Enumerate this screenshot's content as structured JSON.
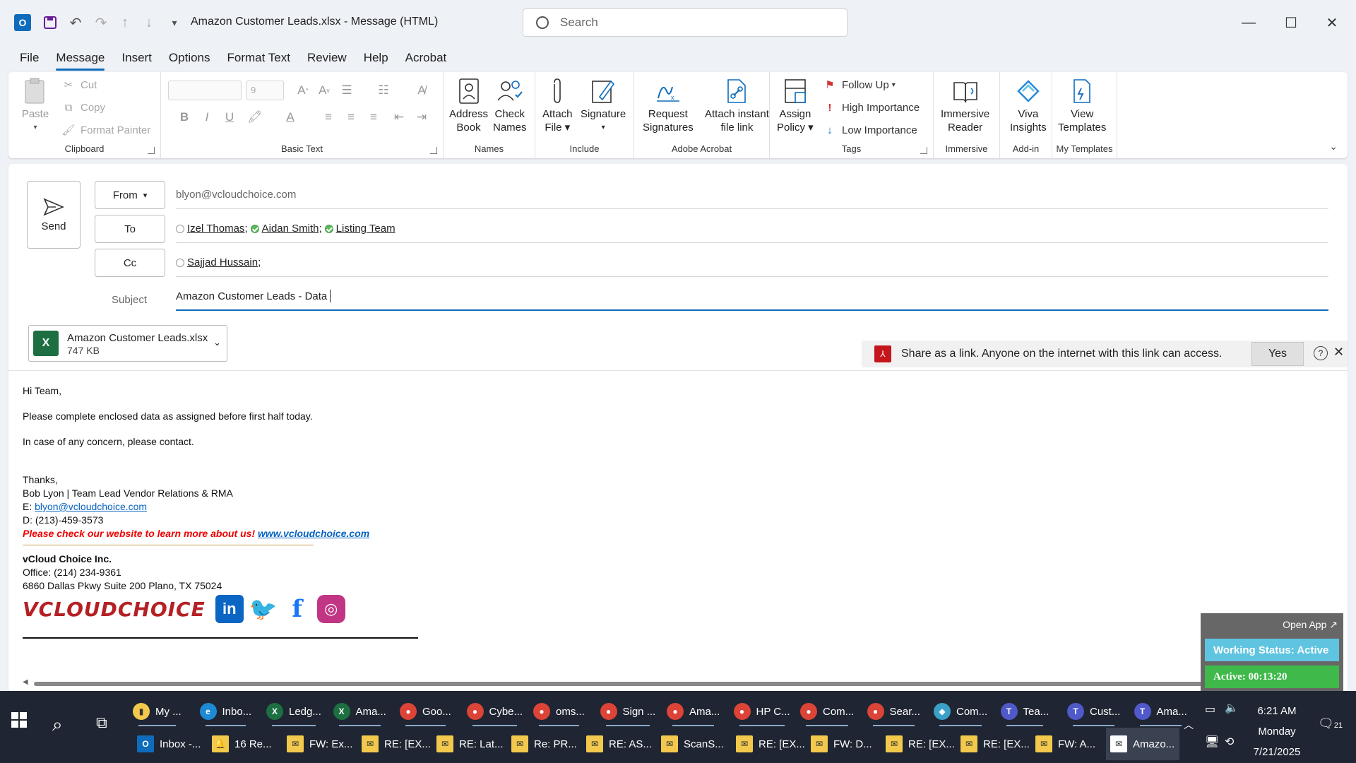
{
  "window": {
    "title": "Amazon Customer Leads.xlsx  -  Message (HTML)",
    "search_placeholder": "Search"
  },
  "menu": [
    "File",
    "Message",
    "Insert",
    "Options",
    "Format Text",
    "Review",
    "Help",
    "Acrobat"
  ],
  "ribbon": {
    "clipboard": {
      "paste": "Paste",
      "cut": "Cut",
      "copy": "Copy",
      "format_painter": "Format Painter",
      "label": "Clipboard"
    },
    "basic_text": {
      "font_size": "9",
      "label": "Basic Text"
    },
    "names": {
      "address_book_1": "Address",
      "address_book_2": "Book",
      "check_names_1": "Check",
      "check_names_2": "Names",
      "label": "Names"
    },
    "include": {
      "attach_1": "Attach",
      "attach_2": "File",
      "signature": "Signature",
      "label": "Include"
    },
    "acrobat": {
      "request_1": "Request",
      "request_2": "Signatures",
      "instant_1": "Attach instant",
      "instant_2": "file link",
      "label": "Adobe Acrobat"
    },
    "tags": {
      "assign_1": "Assign",
      "assign_2": "Policy",
      "follow_up": "Follow Up",
      "high": "High Importance",
      "low": "Low Importance",
      "label": "Tags"
    },
    "immersive": {
      "btn_1": "Immersive",
      "btn_2": "Reader",
      "label": "Immersive"
    },
    "addin": {
      "btn_1": "Viva",
      "btn_2": "Insights",
      "label": "Add-in"
    },
    "templates": {
      "btn_1": "View",
      "btn_2": "Templates",
      "label": "My Templates"
    }
  },
  "compose": {
    "send": "Send",
    "from_label": "From",
    "from_value": "blyon@vcloudchoice.com",
    "to_label": "To",
    "to": [
      {
        "name": "Izel Thomas",
        "status": "empty"
      },
      {
        "name": "Aidan Smith",
        "status": "green"
      },
      {
        "name": "Listing Team",
        "status": "green"
      }
    ],
    "cc_label": "Cc",
    "cc": [
      {
        "name": "Sajjad Hussain",
        "status": "empty"
      }
    ],
    "subject_label": "Subject",
    "subject_value": "Amazon Customer Leads -  Data",
    "attachment": {
      "name": "Amazon Customer Leads.xlsx",
      "size": "747 KB"
    },
    "share_text": "Share as a link. Anyone on the internet with this link can access.",
    "share_yes": "Yes"
  },
  "body": {
    "greeting": "Hi Team,",
    "line1": "Please complete enclosed data as assigned before first half today.",
    "line2": "In case of any concern, please contact.",
    "thanks": "Thanks,",
    "sig_name": "Bob Lyon | Team Lead Vendor Relations & RMA",
    "email_prefix": "E: ",
    "email": "blyon@vcloudchoice.com",
    "phone": "D: (213)-459-3573",
    "promo": "Please check our website to learn more about us! ",
    "website": "www.vcloudchoice.com",
    "company": "vCloud Choice Inc.",
    "office": "Office: (214) 234-9361",
    "address": "6860 Dallas Pkwy Suite 200 Plano, TX 75024",
    "logo_text": "VCLOUDCHOICE"
  },
  "widget": {
    "open_app": "Open App ↗",
    "status": "Working Status: Active",
    "active": "Active: 00:13:20"
  },
  "taskbar": {
    "row1": [
      {
        "label": "My ...",
        "icon": "folder-icon",
        "color": "#f2c94c"
      },
      {
        "label": "Inbo...",
        "icon": "edge-icon",
        "color": "#1e8ad6"
      },
      {
        "label": "Ledg...",
        "icon": "excel-icon",
        "color": "#1d6f42"
      },
      {
        "label": "Ama...",
        "icon": "excel-icon",
        "color": "#1d6f42"
      },
      {
        "label": "Goo...",
        "icon": "chrome-icon",
        "color": "#db4437"
      },
      {
        "label": "Cybe...",
        "icon": "chrome-icon",
        "color": "#db4437"
      },
      {
        "label": "oms...",
        "icon": "chrome-icon",
        "color": "#db4437"
      },
      {
        "label": "Sign ...",
        "icon": "chrome-icon",
        "color": "#db4437"
      },
      {
        "label": "Ama...",
        "icon": "chrome-icon",
        "color": "#db4437"
      },
      {
        "label": "HP C...",
        "icon": "chrome-icon",
        "color": "#db4437"
      },
      {
        "label": "Com...",
        "icon": "chrome-icon",
        "color": "#db4437"
      },
      {
        "label": "Sear...",
        "icon": "chrome-icon",
        "color": "#db4437"
      },
      {
        "label": "Com...",
        "icon": "app-icon",
        "color": "#3aa0c8"
      },
      {
        "label": "Tea...",
        "icon": "teams-icon",
        "color": "#5059c9"
      },
      {
        "label": "Cust...",
        "icon": "teams-icon",
        "color": "#5059c9"
      },
      {
        "label": "Ama...",
        "icon": "teams-icon",
        "color": "#5059c9"
      }
    ],
    "row2": [
      {
        "label": "Inbox -...",
        "icon": "outlook-icon",
        "color": "#0f6cbd"
      },
      {
        "label": "16 Re...",
        "icon": "bell-icon",
        "color": "#f2c94c"
      },
      {
        "label": "FW: Ex...",
        "icon": "mail-icon",
        "color": "#f2c94c"
      },
      {
        "label": "RE: [EX...",
        "icon": "mail-icon",
        "color": "#f2c94c"
      },
      {
        "label": "RE: Lat...",
        "icon": "mail-icon",
        "color": "#f2c94c"
      },
      {
        "label": "Re: PR...",
        "icon": "mail-icon",
        "color": "#f2c94c"
      },
      {
        "label": "RE: AS...",
        "icon": "mail-icon",
        "color": "#f2c94c"
      },
      {
        "label": "ScanS...",
        "icon": "mail-icon",
        "color": "#f2c94c"
      },
      {
        "label": "RE: [EX...",
        "icon": "mail-icon",
        "color": "#f2c94c"
      },
      {
        "label": "FW: D...",
        "icon": "mail-icon",
        "color": "#f2c94c"
      },
      {
        "label": "RE: [EX...",
        "icon": "mail-icon",
        "color": "#f2c94c"
      },
      {
        "label": "RE: [EX...",
        "icon": "mail-icon",
        "color": "#f2c94c"
      },
      {
        "label": "FW: A...",
        "icon": "mail-icon",
        "color": "#f2c94c"
      },
      {
        "label": "Amazo...",
        "icon": "mail-icon",
        "color": "#ffffff"
      }
    ],
    "time": "6:21 AM",
    "day": "Monday",
    "date": "7/21/2025",
    "notif_count": "21"
  }
}
